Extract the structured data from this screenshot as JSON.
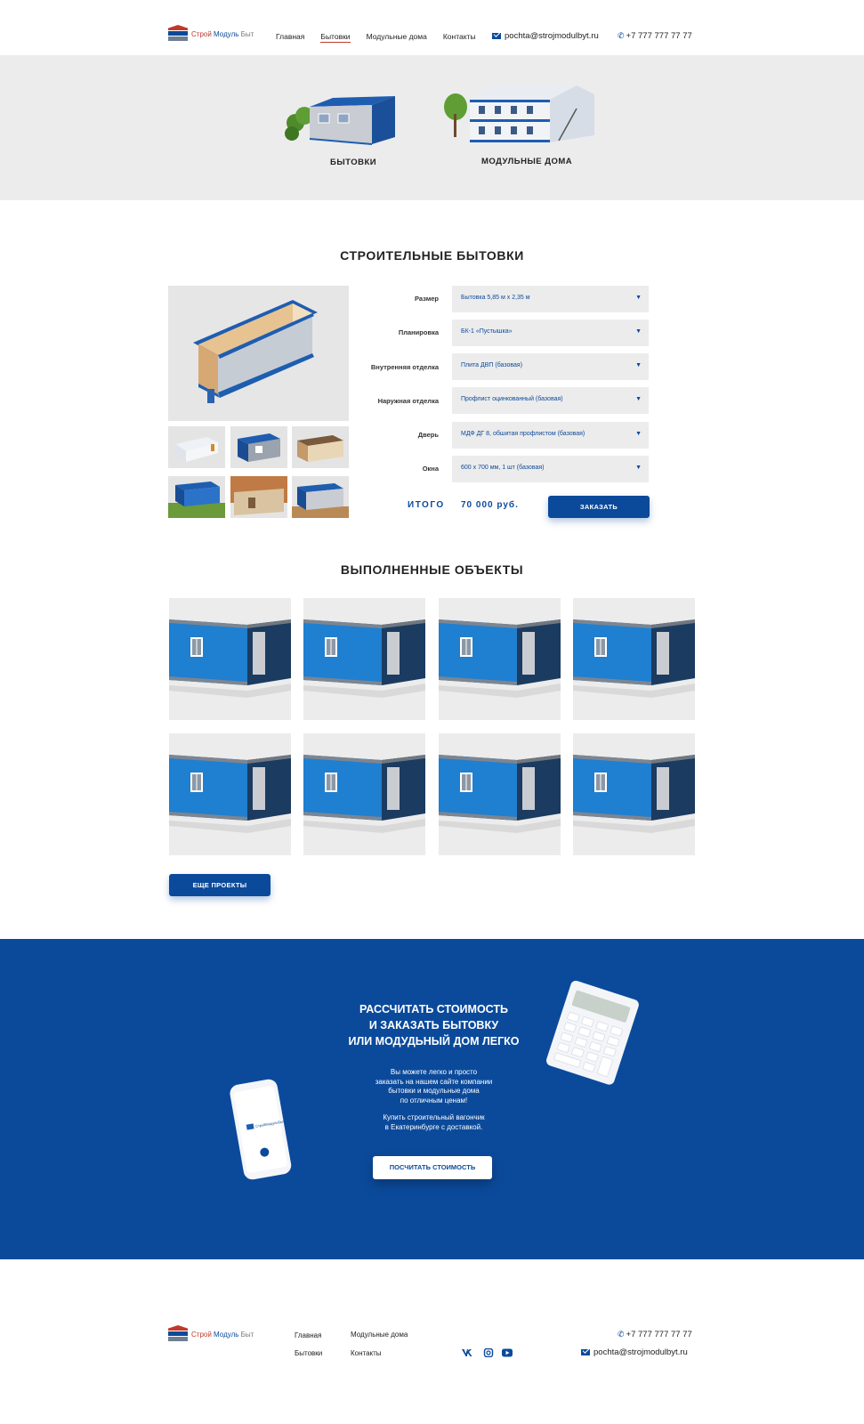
{
  "header": {
    "logo": {
      "part1": "Строй",
      "part2": "Модуль",
      "part3": "Быт"
    },
    "nav": [
      "Главная",
      "Бытовки",
      "Модульные дома",
      "Контакты"
    ],
    "active_nav": "Бытовки",
    "email": "pochta@strojmodulbyt.ru",
    "phone": "+7 777 777 77 77"
  },
  "hero": {
    "categories": [
      {
        "label": "БЫТОВКИ",
        "icon": "cabin-image"
      },
      {
        "label": "МОДУЛЬНЫЕ ДОМА",
        "icon": "modular-house-image"
      }
    ]
  },
  "configurator": {
    "title": "СТРОИТЕЛЬНЫЕ БЫТОВКИ",
    "options": [
      {
        "label": "Размер",
        "value": "Бытовка 5,85 м х 2,35 м"
      },
      {
        "label": "Планировка",
        "value": "БК-1 «Пустышка»"
      },
      {
        "label": "Внутренняя отделка",
        "value": "Плита ДВП (базовая)"
      },
      {
        "label": "Наружная отделка",
        "value": "Профлист оцинкованный (базовая)"
      },
      {
        "label": "Дверь",
        "value": "МДФ ДГ 8, обшитая профлистом (базовая)"
      },
      {
        "label": "Окна",
        "value": "600 х 700 мм, 1 шт (базовая)"
      }
    ],
    "total_label": "ИТОГО",
    "total_value": "70 000 руб.",
    "order_button": "ЗАКАЗАТЬ"
  },
  "projects": {
    "title": "ВЫПОЛНЕННЫЕ ОБЪЕКТЫ",
    "count": 8,
    "more_button": "ЕЩЕ ПРОЕКТЫ"
  },
  "cta": {
    "title_lines": [
      "РАССЧИТАТЬ СТОИМОСТЬ",
      "И ЗАКАЗАТЬ БЫТОВКУ",
      "ИЛИ МОДУДЬНЫЙ ДОМ ЛЕГКО"
    ],
    "text1_lines": [
      "Вы можете легко и просто",
      "заказать на нашем сайте компании",
      "бытовки и модульные дома",
      "по отличным ценам!"
    ],
    "text2_lines": [
      "Купить строительный вагончик",
      "в Екатеринбурге с доставкой."
    ],
    "button": "ПОСЧИТАТЬ СТОИМОСТЬ",
    "phone_logo": "СтройМодульБыт"
  },
  "footer": {
    "logo": {
      "part1": "Строй",
      "part2": "Модуль",
      "part3": "Быт"
    },
    "nav": [
      "Главная",
      "Бытовки",
      "Модульные дома",
      "Контакты"
    ],
    "social": [
      "vk-icon",
      "instagram-icon",
      "youtube-icon"
    ],
    "phone": "+7 777 777 77 77",
    "email": "pochta@strojmodulbyt.ru"
  },
  "colors": {
    "brand_blue": "#0b4a9b",
    "accent_red": "#c0392b",
    "gray_bg": "#ececec"
  }
}
